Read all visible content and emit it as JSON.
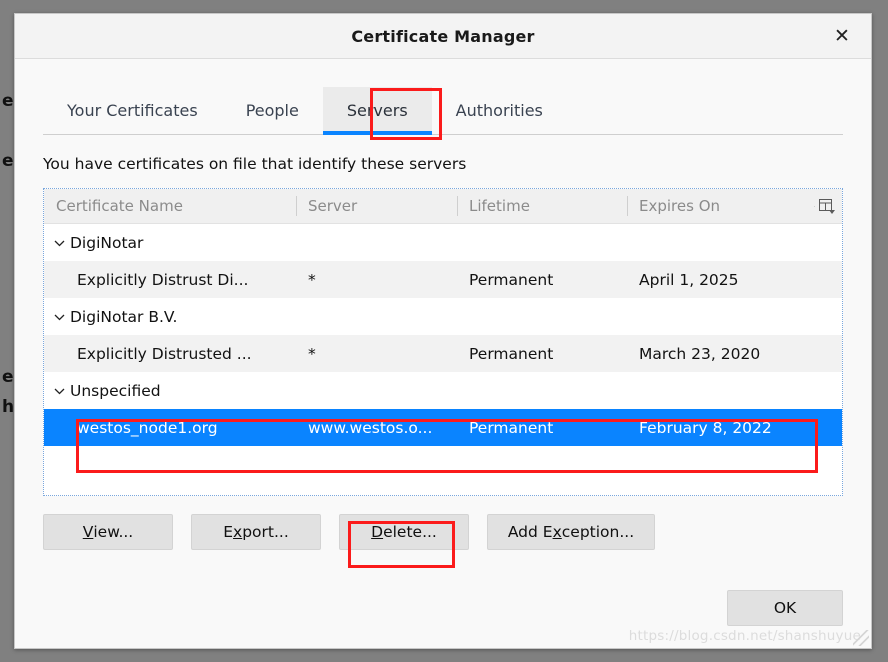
{
  "window": {
    "title": "Certificate Manager",
    "close_icon": "close-icon"
  },
  "tabs": [
    {
      "label": "Your Certificates",
      "selected": false
    },
    {
      "label": "People",
      "selected": false
    },
    {
      "label": "Servers",
      "selected": true
    },
    {
      "label": "Authorities",
      "selected": false
    }
  ],
  "description": "You have certificates on file that identify these servers",
  "table": {
    "columns": [
      "Certificate Name",
      "Server",
      "Lifetime",
      "Expires On"
    ],
    "column_picker_icon": "column-picker-icon",
    "rows": [
      {
        "type": "group",
        "label": "DigiNotar",
        "twisty": "chevron-down-icon"
      },
      {
        "type": "leaf",
        "name": "Explicitly Distrust Di...",
        "server": "*",
        "lifetime": "Permanent",
        "expires": "April 1, 2025",
        "selected": false
      },
      {
        "type": "group",
        "label": "DigiNotar B.V.",
        "twisty": "chevron-down-icon"
      },
      {
        "type": "leaf",
        "name": "Explicitly Distrusted ...",
        "server": "*",
        "lifetime": "Permanent",
        "expires": "March 23, 2020",
        "selected": false
      },
      {
        "type": "group",
        "label": "Unspecified",
        "twisty": "chevron-down-icon"
      },
      {
        "type": "leaf",
        "name": "westos_node1.org",
        "server": "www.westos.o...",
        "lifetime": "Permanent",
        "expires": "February 8, 2022",
        "selected": true
      }
    ]
  },
  "buttons": {
    "view": {
      "pre": "",
      "mnemonic": "V",
      "post": "iew..."
    },
    "export": {
      "pre": "E",
      "mnemonic": "x",
      "post": "port..."
    },
    "delete": {
      "pre": "",
      "mnemonic": "D",
      "post": "elete..."
    },
    "add_exception": {
      "pre": "Add E",
      "mnemonic": "x",
      "post": "ception..."
    }
  },
  "ok_button": "OK",
  "watermark": "https://blog.csdn.net/shanshuyue",
  "background_fragments": [
    "e",
    "ed",
    "er",
    "h"
  ],
  "colors": {
    "accent": "#0a84ff",
    "annotation": "#fb1b1b",
    "selected_row": "#0a84ff",
    "dialog_bg": "#f9f9f9",
    "titlebar_bg": "#f3f3f3",
    "button_bg": "#e1e1e1"
  }
}
